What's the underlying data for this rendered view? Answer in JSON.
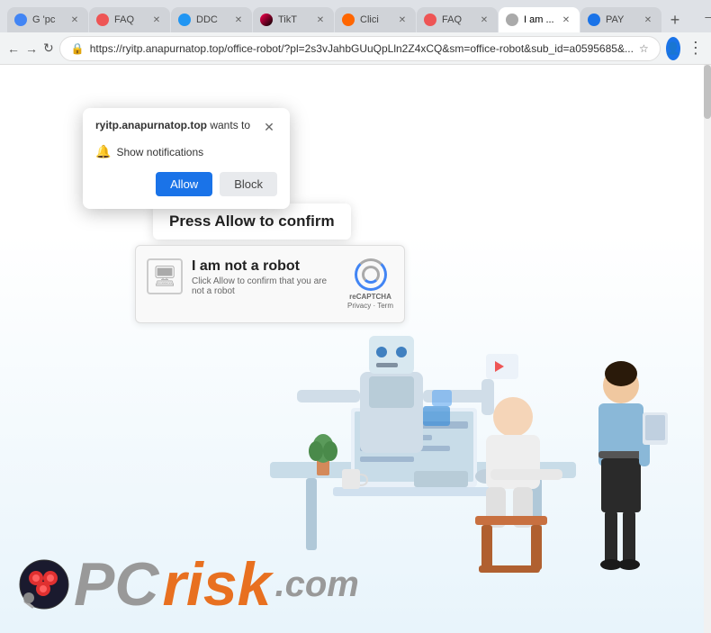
{
  "browser": {
    "tabs": [
      {
        "id": "t1",
        "label": "G 'pc",
        "active": false,
        "fav_class": "fav-google"
      },
      {
        "id": "t2",
        "label": "FAQ",
        "active": false,
        "fav_class": "fav-faq"
      },
      {
        "id": "t3",
        "label": "DDC",
        "active": false,
        "fav_class": "fav-ddc"
      },
      {
        "id": "t4",
        "label": "TikT",
        "active": false,
        "fav_class": "fav-tiktok"
      },
      {
        "id": "t5",
        "label": "Clici",
        "active": false,
        "fav_class": "fav-cli"
      },
      {
        "id": "t6",
        "label": "FAQ",
        "active": false,
        "fav_class": "fav-faq2"
      },
      {
        "id": "t7",
        "label": "I am ...",
        "active": true,
        "fav_class": "fav-iam"
      },
      {
        "id": "t8",
        "label": "PAY",
        "active": false,
        "fav_class": "fav-pay"
      }
    ],
    "url": "https://ryitp.anapurnatop.top/office-robot/?pl=2s3vJahbGUuQpLln2Z4xCQ&sm=office-robot&sub_id=a0595685&..."
  },
  "popup": {
    "domain": "ryitp.anapurnatop.top",
    "wants_to": " wants to",
    "notification_text": "Show notifications",
    "allow_label": "Allow",
    "block_label": "Block"
  },
  "press_allow": {
    "label": "Press Allow to confirm"
  },
  "captcha": {
    "title": "I am not a robot",
    "subtitle": "Click Allow to confirm that you are not a robot",
    "recaptcha_label": "reCAPTCHA",
    "links": "Privacy · Term"
  },
  "pcrisk": {
    "pc_text": "PC",
    "risk_text": "risk",
    "com_text": ".com"
  }
}
